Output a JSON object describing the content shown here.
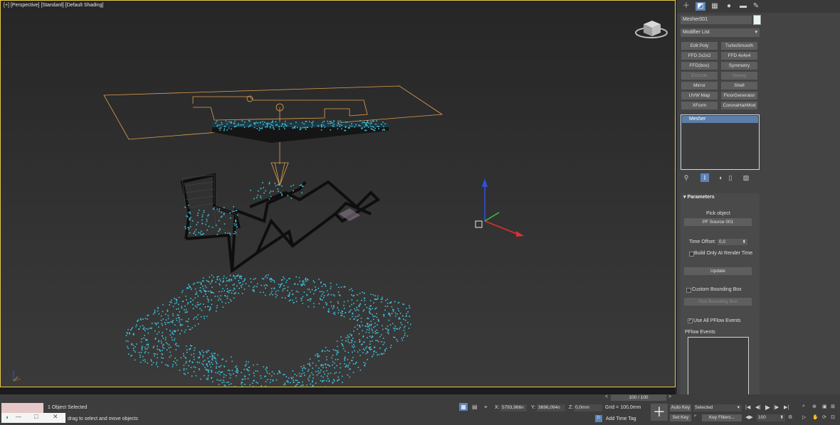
{
  "viewport": {
    "labels": [
      "[+]",
      "[Perspective]",
      "[Standard]",
      "[Default Shading]"
    ]
  },
  "command_panel": {
    "tab_icons": [
      "create-icon",
      "modify-icon",
      "hierarchy-icon",
      "motion-icon",
      "display-icon",
      "utilities-icon"
    ],
    "object_name": "Mesher001",
    "modifier_list_label": "Modifier List",
    "modifier_buttons": [
      {
        "label": "Edit Poly",
        "enabled": true
      },
      {
        "label": "TurboSmooth",
        "enabled": true
      },
      {
        "label": "FFD 2x2x2",
        "enabled": true
      },
      {
        "label": "FFD 4x4x4",
        "enabled": true
      },
      {
        "label": "FFD(box)",
        "enabled": true
      },
      {
        "label": "Symmetry",
        "enabled": true
      },
      {
        "label": "Extrude",
        "enabled": false
      },
      {
        "label": "Sweep",
        "enabled": false
      },
      {
        "label": "Mirror",
        "enabled": true
      },
      {
        "label": "Shell",
        "enabled": true
      },
      {
        "label": "UVW Map",
        "enabled": true
      },
      {
        "label": "FloorGenerator",
        "enabled": true
      },
      {
        "label": "XForm",
        "enabled": true
      },
      {
        "label": "CoronaHairMod",
        "enabled": true
      }
    ],
    "stack_item": "Mesher",
    "parameters": {
      "title": "Parameters",
      "pick_object_label": "Pick object",
      "pick_object_value": "PF Source 001",
      "time_offset_label": "Time Offset:",
      "time_offset_value": "0,0",
      "build_only_label": "Build Only At Render Time",
      "build_only_checked": false,
      "update_label": "Update",
      "custom_bbox_label": "Custom Bounding Box",
      "custom_bbox_checked": false,
      "pick_bbox_label": "Pick Bounding Box",
      "use_all_label": "Use All PFlow Events",
      "use_all_checked": true,
      "pflow_events_label": "PFlow Events"
    }
  },
  "timeline": {
    "frame_label": "100 / 100"
  },
  "status": {
    "selection": "1 Object Selected",
    "prompt": "drag to select and move objects",
    "x_label": "X:",
    "x_value": "5793,966n",
    "y_label": "Y:",
    "y_value": "3696,094n",
    "z_label": "Z:",
    "z_value": "0,0mm",
    "grid": "Grid = 100,0mm",
    "add_time_tag": "Add Time Tag"
  },
  "animation": {
    "auto_key": "Auto Key",
    "set_key": "Set Key",
    "selected": "Selected",
    "key_filters": "Key Filters...",
    "current_frame": "100"
  },
  "colors": {
    "viewport_border": "#e7c84a",
    "particles": "#3ec3dd",
    "helper_lines": "#e0a050",
    "axis_x": "#e03030",
    "axis_y": "#40c040",
    "axis_z": "#3050e0"
  }
}
